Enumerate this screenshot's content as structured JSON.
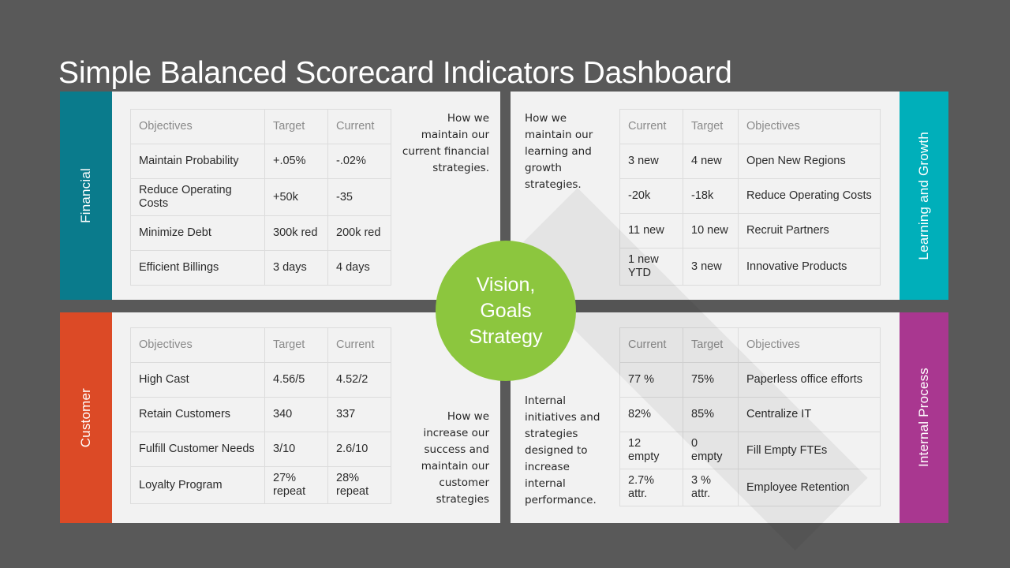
{
  "title": "Simple Balanced Scorecard Indicators Dashboard",
  "colors": {
    "background": "#595959",
    "panel": "#F2F2F2",
    "financial": "#0A7B8C",
    "customer": "#DC4A26",
    "learning": "#00AFBA",
    "internal": "#A93790",
    "center_circle": "#8CC63E",
    "title_text": "#FFFFFF",
    "table_header_text": "#8A8A8A",
    "table_body_text": "#2B2B2B",
    "table_border": "#DCDCDC"
  },
  "center": {
    "lines": [
      "Vision,",
      "Goals",
      "Strategy"
    ],
    "line1": "Vision,",
    "line2": "Goals",
    "line3": "Strategy"
  },
  "quadrants": {
    "financial": {
      "band_label": "Financial",
      "description": "How we maintain our current financial strategies.",
      "headers": [
        "Objectives",
        "Target",
        "Current"
      ],
      "header_objectives": "Objectives",
      "header_target": "Target",
      "header_current": "Current",
      "rows": [
        {
          "objective": "Maintain Probability",
          "target": "+.05%",
          "current": "-.02%"
        },
        {
          "objective": "Reduce Operating Costs",
          "target": "+50k",
          "current": "-35"
        },
        {
          "objective": "Minimize Debt",
          "target": "300k red",
          "current": "200k red"
        },
        {
          "objective": "Efficient Billings",
          "target": "3 days",
          "current": "4 days"
        }
      ]
    },
    "customer": {
      "band_label": "Customer",
      "description": "How we increase our success and maintain our customer strategies",
      "headers": [
        "Objectives",
        "Target",
        "Current"
      ],
      "header_objectives": "Objectives",
      "header_target": "Target",
      "header_current": "Current",
      "rows": [
        {
          "objective": "High Cast",
          "target": "4.56/5",
          "current": "4.52/2"
        },
        {
          "objective": "Retain Customers",
          "target": "340",
          "current": "337"
        },
        {
          "objective": "Fulfill Customer Needs",
          "target": "3/10",
          "current": "2.6/10"
        },
        {
          "objective": "Loyalty Program",
          "target": "27% repeat",
          "current": "28% repeat"
        }
      ]
    },
    "learning": {
      "band_label": "Learning and Growth",
      "description": "How we maintain our learning and growth strategies.",
      "headers": [
        "Current",
        "Target",
        "Objectives"
      ],
      "header_current": "Current",
      "header_target": "Target",
      "header_objectives": "Objectives",
      "rows": [
        {
          "current": "3 new",
          "target": "4 new",
          "objective": "Open New Regions"
        },
        {
          "current": "-20k",
          "target": "-18k",
          "objective": "Reduce Operating Costs"
        },
        {
          "current": "11 new",
          "target": "10 new",
          "objective": "Recruit Partners"
        },
        {
          "current": "1 new YTD",
          "target": "3 new",
          "objective": "Innovative Products"
        }
      ]
    },
    "internal": {
      "band_label": "Internal Process",
      "description": "Internal initiatives and strategies designed to increase internal performance.",
      "headers": [
        "Current",
        "Target",
        "Objectives"
      ],
      "header_current": "Current",
      "header_target": "Target",
      "header_objectives": "Objectives",
      "rows": [
        {
          "current": "77 %",
          "target": "75%",
          "objective": "Paperless office efforts"
        },
        {
          "current": "82%",
          "target": "85%",
          "objective": "Centralize IT"
        },
        {
          "current": "12 empty",
          "target": "0 empty",
          "objective": "Fill Empty FTEs"
        },
        {
          "current": "2.7% attr.",
          "target": "3 % attr.",
          "objective": "Employee Retention"
        }
      ]
    }
  }
}
